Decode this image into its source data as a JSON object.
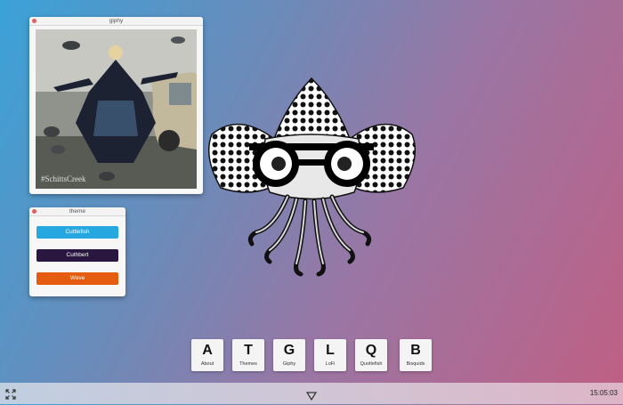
{
  "giphy_window": {
    "title": "giphy",
    "watermark": "#SchittsCreek"
  },
  "theme_window": {
    "title": "theme",
    "buttons": [
      {
        "label": "Cuttlefish",
        "color": "#26a7df"
      },
      {
        "label": "Cuthbert",
        "color": "#2a1740"
      },
      {
        "label": "Wave",
        "color": "#e55c10"
      }
    ]
  },
  "dock": {
    "items": [
      {
        "letter": "A",
        "label": "About"
      },
      {
        "letter": "T",
        "label": "Themes"
      },
      {
        "letter": "G",
        "label": "Giphy"
      },
      {
        "letter": "L",
        "label": "LoFi"
      },
      {
        "letter": "Q",
        "label": "Quotlefish"
      },
      {
        "letter": "B",
        "label": "Bisquids"
      }
    ]
  },
  "bottom_bar": {
    "fullscreen_icon": "expand-icon",
    "menu_icon": "triangle-down-icon",
    "clock": "15:05:03"
  },
  "mascot": {
    "icon": "cuttlefish-with-glasses-icon"
  }
}
